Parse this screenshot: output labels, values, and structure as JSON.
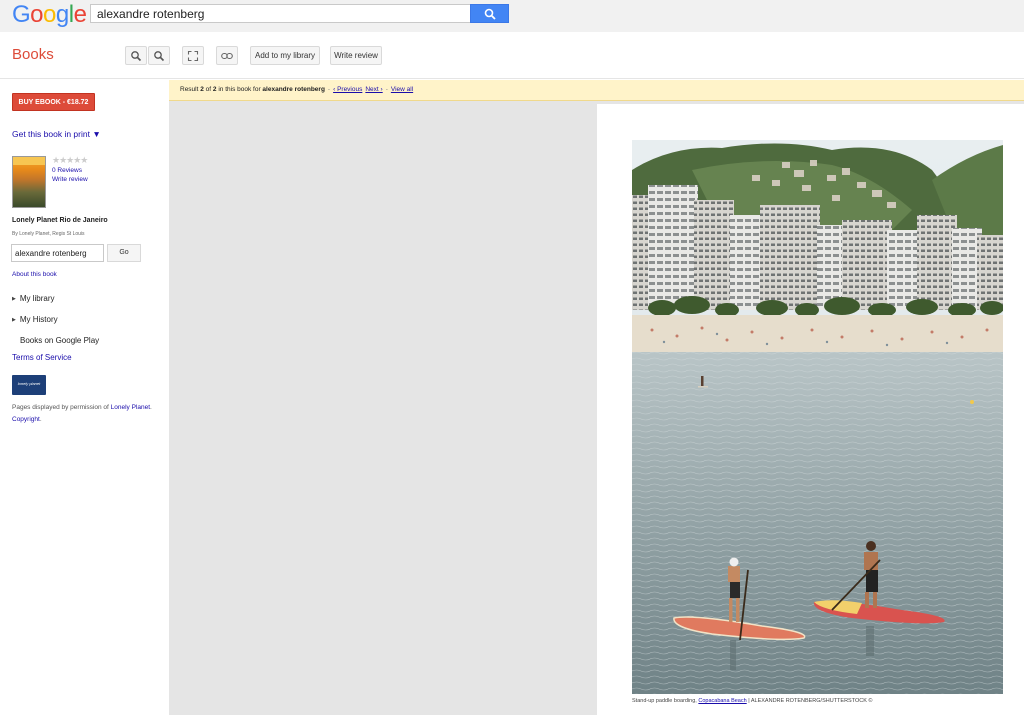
{
  "search": {
    "query": "alexandre rotenberg"
  },
  "logo": {
    "letters": [
      {
        "ch": "G",
        "color": "#4285f4"
      },
      {
        "ch": "o",
        "color": "#ea4335"
      },
      {
        "ch": "o",
        "color": "#fbbc05"
      },
      {
        "ch": "g",
        "color": "#4285f4"
      },
      {
        "ch": "l",
        "color": "#34a853"
      },
      {
        "ch": "e",
        "color": "#ea4335"
      }
    ]
  },
  "header": {
    "books_title": "Books",
    "add_library_label": "Add to my library",
    "write_review_label": "Write review"
  },
  "sidebar": {
    "buy_ebook": "BUY EBOOK - €18.72",
    "get_print": "Get this book in print ▼",
    "stars": "★★★★★",
    "reviews": "0 Reviews",
    "write_review": "Write review",
    "book_title": "Lonely Planet Rio de Janeiro",
    "book_authors": "By Lonely Planet, Regis St Louis",
    "search_value": "alexandre rotenberg",
    "go_label": "Go",
    "about": "About this book",
    "my_library": "My library",
    "my_history": "My History",
    "google_play": "Books on Google Play",
    "terms": "Terms of Service",
    "publisher_logo_text": "lonely planet",
    "permission_prefix": "Pages displayed by permission of ",
    "permission_link1": "Lonely Planet",
    "permission_sep": ". ",
    "permission_link2": "Copyright",
    "permission_suffix": "."
  },
  "banner": {
    "result_prefix": "Result ",
    "result_num": "2",
    "result_of": " of ",
    "result_total": "2",
    "result_mid": " in this book for ",
    "result_query": "alexandre rotenberg",
    "sep": "-",
    "previous": "‹ Previous",
    "next": "Next ›",
    "view_all": "View all"
  },
  "page": {
    "caption_prefix": "Stand-up paddle boarding, ",
    "caption_link": "Copacabana Beach",
    "caption_suffix": " | ALEXANDRE ROTENBERG/SHUTTERSTOCK ©"
  },
  "colors": {
    "accent_red": "#dd4b39",
    "search_blue": "#4285f4",
    "banner_yellow": "#fff3c9",
    "link_blue": "#1a0dab"
  }
}
